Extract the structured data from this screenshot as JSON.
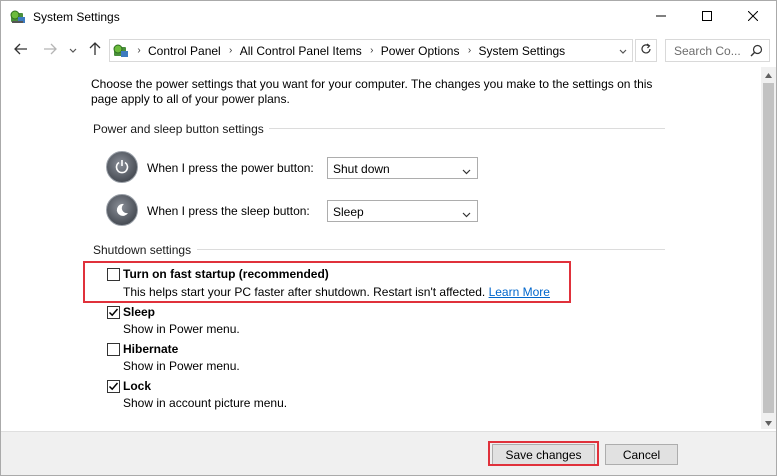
{
  "window": {
    "title": "System Settings",
    "icon": "control-panel-icon",
    "controls": [
      "minimize-icon",
      "maximize-icon",
      "close-icon"
    ]
  },
  "navigation": {
    "breadcrumbs": [
      "Control Panel",
      "All Control Panel Items",
      "Power Options",
      "System Settings"
    ],
    "search_placeholder": "Search Co..."
  },
  "intro_text": "Choose the power settings that you want for your computer. The changes you make to the settings on this page apply to all of your power plans.",
  "power_sleep": {
    "heading": "Power and sleep button settings",
    "power_button_label": "When I press the power button:",
    "power_button_value": "Shut down",
    "sleep_button_label": "When I press the sleep button:",
    "sleep_button_value": "Sleep"
  },
  "shutdown": {
    "heading": "Shutdown settings",
    "options": [
      {
        "title": "Turn on fast startup (recommended)",
        "desc": "This helps start your PC faster after shutdown. Restart isn't affected.",
        "link": "Learn More",
        "checked": false
      },
      {
        "title": "Sleep",
        "desc": "Show in Power menu.",
        "checked": true
      },
      {
        "title": "Hibernate",
        "desc": "Show in Power menu.",
        "checked": false
      },
      {
        "title": "Lock",
        "desc": "Show in account picture menu.",
        "checked": true
      }
    ]
  },
  "footer": {
    "save_label": "Save changes",
    "cancel_label": "Cancel"
  },
  "colors": {
    "highlight": "#e0313b",
    "link": "#0066cc",
    "footer_bg": "#f0f0f0"
  }
}
